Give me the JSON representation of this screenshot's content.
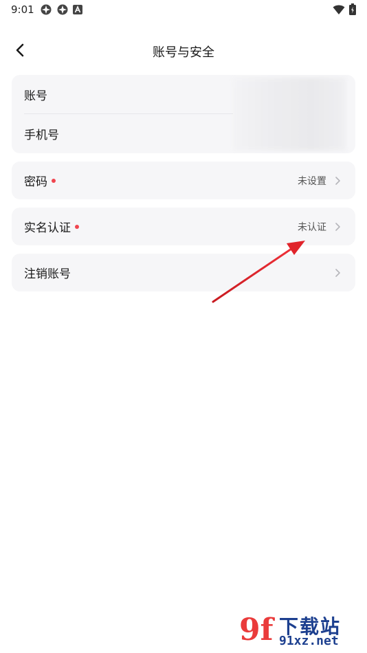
{
  "status_bar": {
    "time": "9:01",
    "left_icons": [
      "app-icon",
      "app-icon",
      "a-icon"
    ],
    "right_icons": [
      "wifi-icon",
      "battery-icon"
    ]
  },
  "nav": {
    "title": "账号与安全",
    "back_icon": "chevron-left-icon"
  },
  "account_card": {
    "account_label": "账号",
    "phone_label": "手机号"
  },
  "password_row": {
    "label": "密码",
    "value": "未设置"
  },
  "realname_row": {
    "label": "实名认证",
    "value": "未认证"
  },
  "cancel_row": {
    "label": "注销账号"
  },
  "colors": {
    "accent_red": "#f0454f",
    "card_bg": "#f6f6f8",
    "annotation_arrow": "#e0242b"
  },
  "watermark": {
    "logo": "9f",
    "title": "下载站",
    "domain": "91xz.net"
  }
}
